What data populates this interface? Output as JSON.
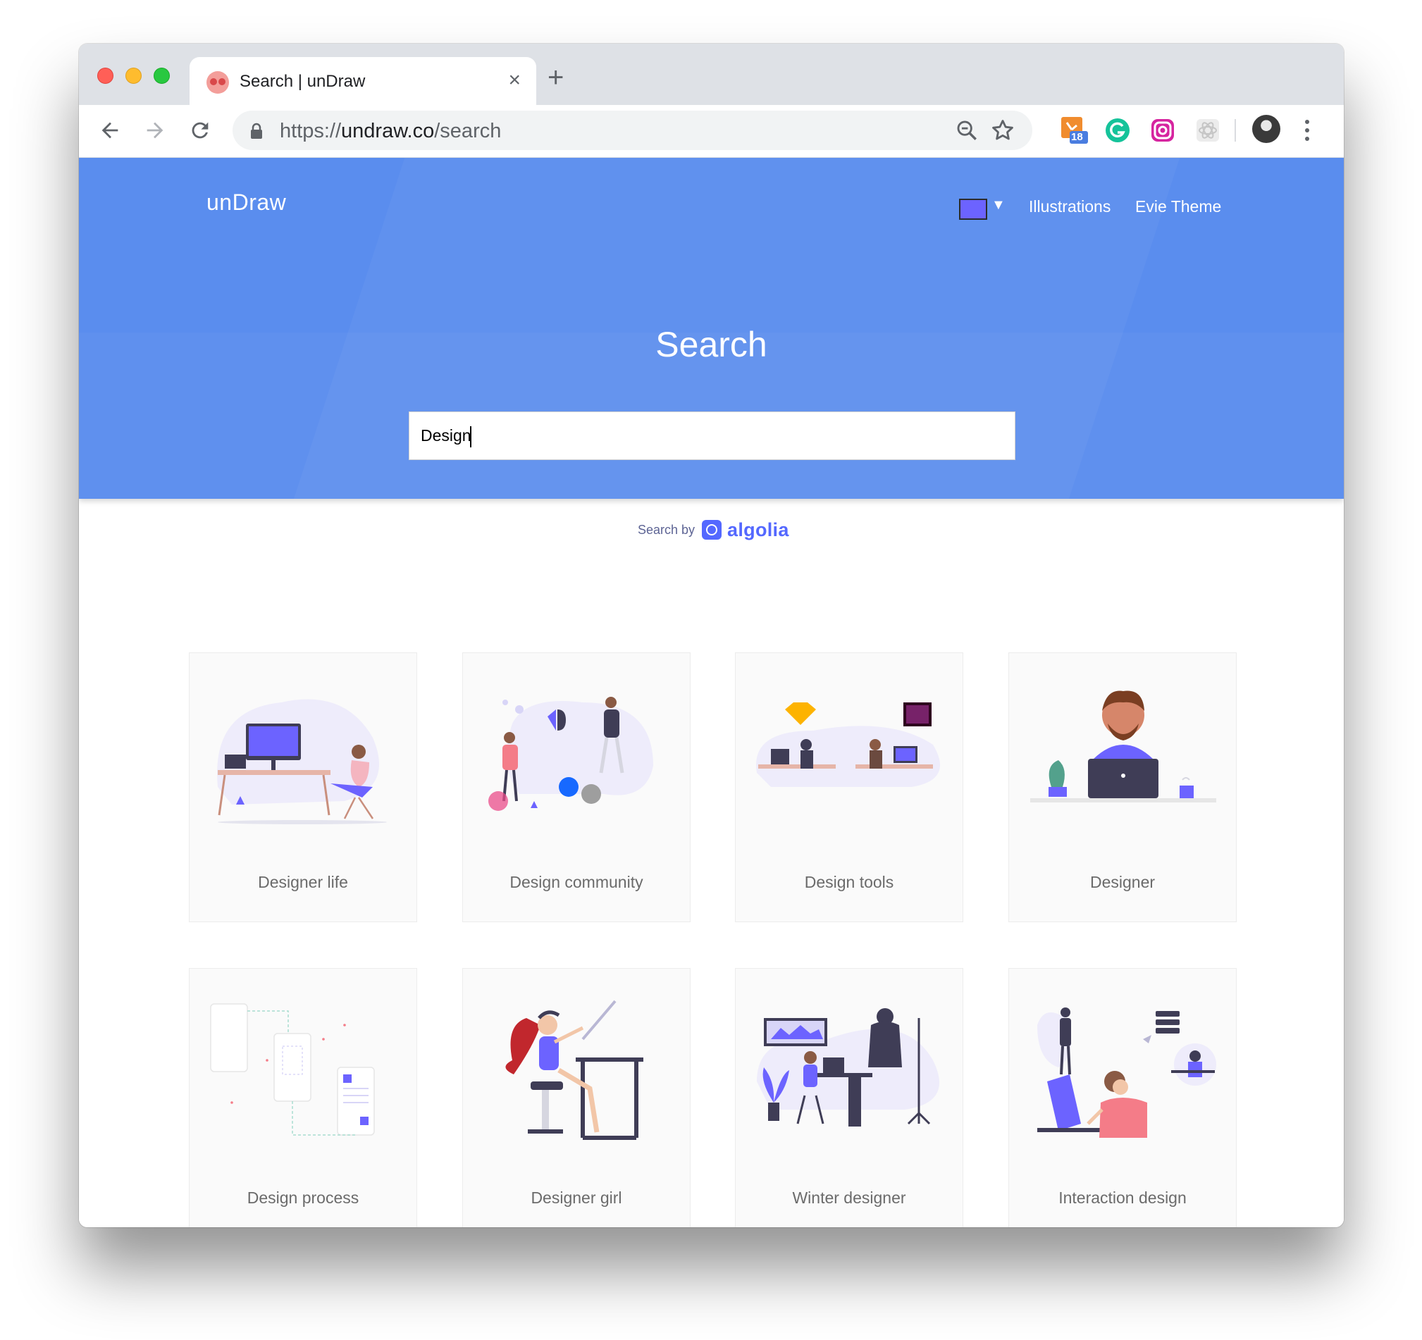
{
  "browser": {
    "tab_title": "Search | unDraw",
    "tab_close": "×",
    "new_tab": "+",
    "url_scheme": "https://",
    "url_host": "undraw.co",
    "url_path": "/search",
    "extension_badge": "18"
  },
  "header": {
    "brand": "unDraw",
    "color_swatch": "#6c63ff",
    "color_caret": "▼",
    "nav": [
      "Illustrations",
      "Evie Theme"
    ]
  },
  "hero": {
    "title": "Search",
    "query": "Design"
  },
  "attribution": {
    "by": "Search by",
    "brand": "algolia"
  },
  "cards": [
    {
      "label": "Designer life"
    },
    {
      "label": "Design community"
    },
    {
      "label": "Design tools"
    },
    {
      "label": "Designer"
    },
    {
      "label": "Design process"
    },
    {
      "label": "Designer girl"
    },
    {
      "label": "Winter designer"
    },
    {
      "label": "Interaction design"
    }
  ],
  "colors": {
    "hero_background": "#5a8dee",
    "accent": "#6c63ff"
  }
}
